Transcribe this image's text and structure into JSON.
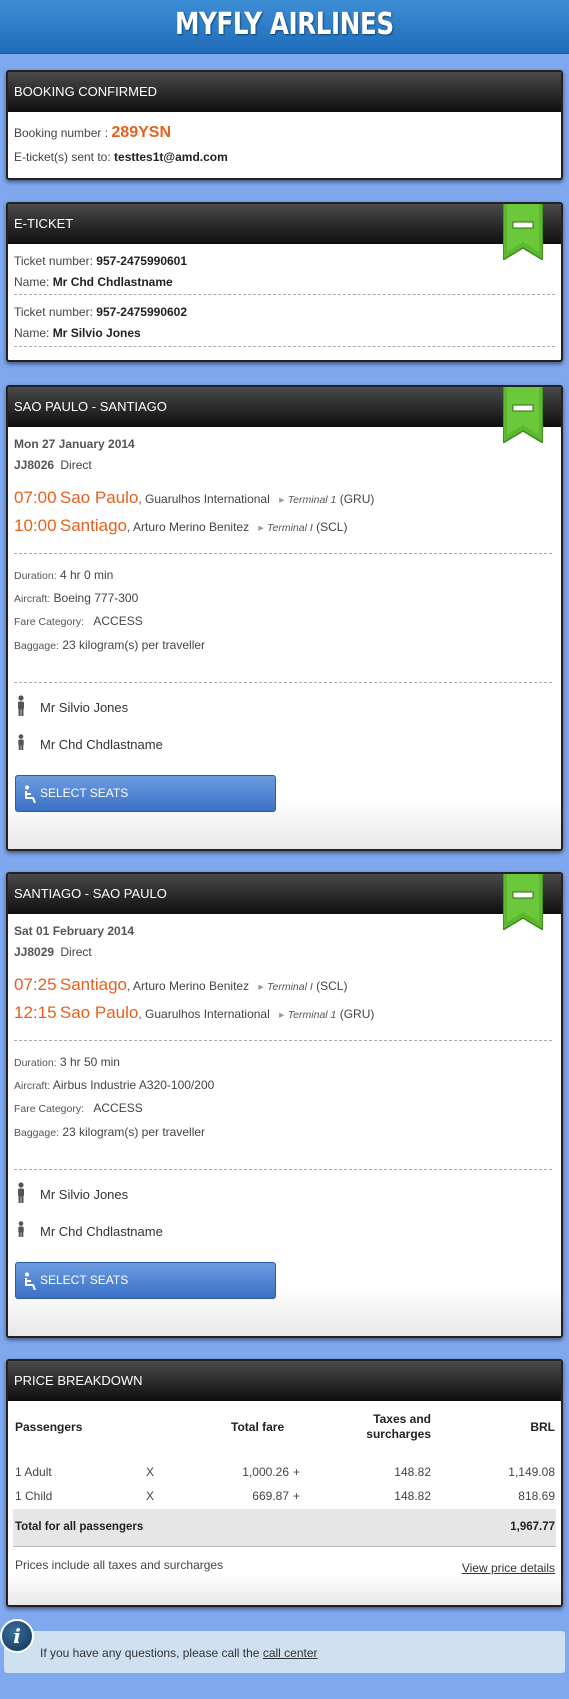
{
  "header": {
    "title": "MYFLY AIRLINES"
  },
  "booking": {
    "title": "BOOKING CONFIRMED",
    "number_label": "Booking number :",
    "number": "289YSN",
    "sent_label": "E-ticket(s) sent to:",
    "email": "testtes1t@amd.com"
  },
  "eticket": {
    "title": "E-TICKET",
    "toggle_icon": "minus-ribbon-icon",
    "tickets": [
      {
        "number_label": "Ticket number:",
        "number": "957-2475990601",
        "name_label": "Name:",
        "name": "Mr Chd Chdlastname"
      },
      {
        "number_label": "Ticket number:",
        "number": "957-2475990602",
        "name_label": "Name:",
        "name": "Mr Silvio Jones"
      }
    ]
  },
  "flights": [
    {
      "title": "SAO PAULO - SANTIAGO",
      "date": "Mon 27 January 2014",
      "flight_no": "JJ8026",
      "stops": "Direct",
      "dep_time": "07:00",
      "dep_city": "Sao Paulo",
      "dep_airport": ", Guarulhos International",
      "dep_terminal": "Terminal 1",
      "dep_code": "(GRU)",
      "arr_time": "10:00",
      "arr_city": "Santiago",
      "arr_airport": ", Arturo Merino Benitez",
      "arr_terminal": "Terminal I",
      "arr_code": "(SCL)",
      "duration_label": "Duration:",
      "duration": "4 hr 0 min",
      "aircraft_label": "Aircraft:",
      "aircraft": "Boeing 777-300",
      "fare_label": "Fare Category:",
      "fare": "ACCESS",
      "baggage_label": "Baggage:",
      "baggage": "23 kilogram(s) per traveller",
      "passengers": [
        "Mr Silvio Jones",
        "Mr Chd Chdlastname"
      ],
      "select_seats": "SELECT SEATS"
    },
    {
      "title": "SANTIAGO - SAO PAULO",
      "date": "Sat 01 February 2014",
      "flight_no": "JJ8029",
      "stops": "Direct",
      "dep_time": "07:25",
      "dep_city": "Santiago",
      "dep_airport": ", Arturo Merino Benitez",
      "dep_terminal": "Terminal I",
      "dep_code": "(SCL)",
      "arr_time": "12:15",
      "arr_city": "Sao Paulo",
      "arr_airport": ", Guarulhos International",
      "arr_terminal": "Terminal 1",
      "arr_code": "(GRU)",
      "duration_label": "Duration:",
      "duration": "3 hr 50 min",
      "aircraft_label": "Aircraft:",
      "aircraft": "Airbus Industrie A320-100/200",
      "fare_label": "Fare Category:",
      "fare": "ACCESS",
      "baggage_label": "Baggage:",
      "baggage": "23 kilogram(s) per traveller",
      "passengers": [
        "Mr Silvio Jones",
        "Mr Chd Chdlastname"
      ],
      "select_seats": "SELECT SEATS"
    }
  ],
  "price": {
    "title": "PRICE BREAKDOWN",
    "headers": {
      "passengers": "Passengers",
      "total_fare": "Total fare",
      "taxes_line1": "Taxes and",
      "taxes_line2": "surcharges",
      "currency": "BRL"
    },
    "rows": [
      {
        "pax": "1 Adult",
        "x": "X",
        "fare": "1,000.26",
        "plus": "+",
        "taxes": "148.82",
        "total": "1,149.08"
      },
      {
        "pax": "1 Child",
        "x": "X",
        "fare": "669.87",
        "plus": "+",
        "taxes": "148.82",
        "total": "818.69"
      }
    ],
    "total_label": "Total for all passengers",
    "total": "1,967.77",
    "note": "Prices include all taxes and surcharges",
    "details_link": "View price details"
  },
  "info": {
    "icon": "info-icon",
    "text": "If you have any questions, please call the ",
    "link": "call center"
  },
  "colors": {
    "accent": "#e8601c",
    "background": "#7fa8ee",
    "button": "#4a7fd0",
    "ribbon": "#5cb82e"
  }
}
